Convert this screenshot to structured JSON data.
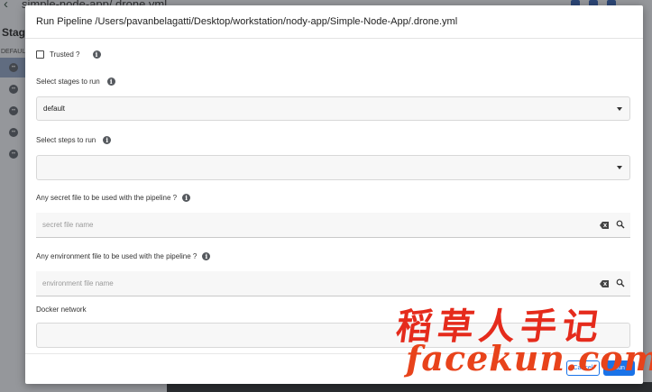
{
  "background": {
    "title": "simple-node-app/.drone.yml",
    "stages_heading": "Stages",
    "default_label": "DEFAULT"
  },
  "modal": {
    "title": "Run Pipeline /Users/pavanbelagatti/Desktop/workstation/nody-app/Simple-Node-App/.drone.yml",
    "trusted_label": "Trusted ?",
    "stages_label": "Select stages to run",
    "stages_value": "default",
    "steps_label": "Select steps to run",
    "steps_value": "",
    "secret_label": "Any secret file to be used with the pipeline ?",
    "secret_placeholder": "secret file name",
    "env_label": "Any environment file to be used with the pipeline ?",
    "env_placeholder": "environment file name",
    "docker_label": "Docker network",
    "cancel_label": "Cancel",
    "run_label": "Run"
  },
  "watermark": {
    "cn": "稻草人手记",
    "en": "facekun.com"
  },
  "colors": {
    "accent": "#1a73e8",
    "watermark": "#e52b1c"
  }
}
